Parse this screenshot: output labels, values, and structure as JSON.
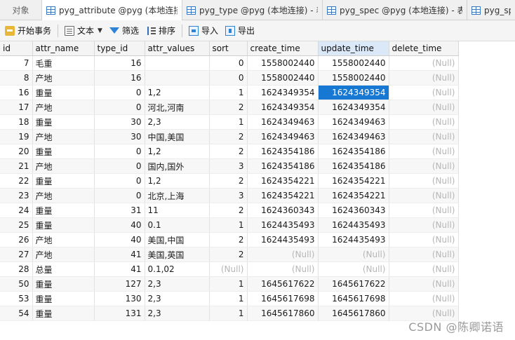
{
  "tabs": [
    {
      "label": "对象",
      "active": false
    },
    {
      "label": "pyg_attribute @pyg (本地连接) - 表",
      "active": true
    },
    {
      "label": "pyg_type @pyg (本地连接) - 表",
      "active": false
    },
    {
      "label": "pyg_spec @pyg (本地连接) - 表",
      "active": false
    },
    {
      "label": "pyg_spec",
      "active": false
    }
  ],
  "toolbar": {
    "begin_tx": "开始事务",
    "text": "文本",
    "filter": "筛选",
    "sort": "排序",
    "import": "导入",
    "export": "导出"
  },
  "columns": [
    "id",
    "attr_name",
    "type_id",
    "attr_values",
    "sort",
    "create_time",
    "update_time",
    "delete_time"
  ],
  "rows": [
    [
      "7",
      "毛重",
      "16",
      "",
      "0",
      "1558002440",
      "1558002440",
      "(Null)"
    ],
    [
      "8",
      "产地",
      "16",
      "",
      "0",
      "1558002440",
      "1558002440",
      "(Null)"
    ],
    [
      "16",
      "重量",
      "0",
      "1,2",
      "1",
      "1624349354",
      "1624349354",
      "(Null)"
    ],
    [
      "17",
      "产地",
      "0",
      "河北,河南",
      "2",
      "1624349354",
      "1624349354",
      "(Null)"
    ],
    [
      "18",
      "重量",
      "30",
      "2,3",
      "1",
      "1624349463",
      "1624349463",
      "(Null)"
    ],
    [
      "19",
      "产地",
      "30",
      "中国,美国",
      "2",
      "1624349463",
      "1624349463",
      "(Null)"
    ],
    [
      "20",
      "重量",
      "0",
      "1,2",
      "2",
      "1624354186",
      "1624354186",
      "(Null)"
    ],
    [
      "21",
      "产地",
      "0",
      "国内,国外",
      "3",
      "1624354186",
      "1624354186",
      "(Null)"
    ],
    [
      "22",
      "重量",
      "0",
      "1,2",
      "2",
      "1624354221",
      "1624354221",
      "(Null)"
    ],
    [
      "23",
      "产地",
      "0",
      "北京,上海",
      "3",
      "1624354221",
      "1624354221",
      "(Null)"
    ],
    [
      "24",
      "重量",
      "31",
      "11",
      "2",
      "1624360343",
      "1624360343",
      "(Null)"
    ],
    [
      "25",
      "重量",
      "40",
      "0.1",
      "1",
      "1624435493",
      "1624435493",
      "(Null)"
    ],
    [
      "26",
      "产地",
      "40",
      "美国,中国",
      "2",
      "1624435493",
      "1624435493",
      "(Null)"
    ],
    [
      "27",
      "产地",
      "41",
      "美国,英国",
      "2",
      "(Null)",
      "(Null)",
      "(Null)"
    ],
    [
      "28",
      "总量",
      "41",
      "0.1,02",
      "(Null)",
      "(Null)",
      "(Null)",
      "(Null)"
    ],
    [
      "50",
      "重量",
      "127",
      "2,3",
      "1",
      "1645617622",
      "1645617622",
      "(Null)"
    ],
    [
      "53",
      "重量",
      "130",
      "2,3",
      "1",
      "1645617698",
      "1645617698",
      "(Null)"
    ],
    [
      "54",
      "重量",
      "131",
      "2,3",
      "1",
      "1645617860",
      "1645617860",
      "(Null)"
    ]
  ],
  "selected_cell": {
    "row": 2,
    "col": 6
  },
  "watermark": "CSDN @陈卿诺语"
}
